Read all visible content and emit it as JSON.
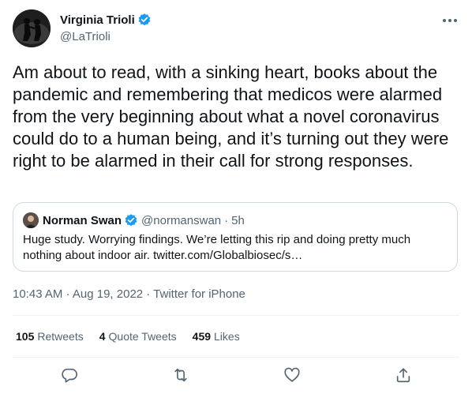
{
  "author": {
    "name": "Virginia Trioli",
    "handle": "@LaTrioli"
  },
  "tweet": {
    "text": "Am about to read, with a sinking heart, books about the pandemic and remembering that medicos were alarmed from the very beginning about what a novel coronavirus could do to a human being, and it’s turning out they were right to be alarmed in their call for strong responses."
  },
  "quote": {
    "name": "Norman Swan",
    "handle": "@normanswan",
    "dot": "·",
    "time": "5h",
    "text": "Huge study. Worrying findings. We’re letting this rip and doing pretty much nothing about indoor air. twitter.com/Globalbiosec/s…"
  },
  "meta": {
    "line": "10:43 AM · Aug 19, 2022 · Twitter for iPhone"
  },
  "stats": {
    "retweets_count": "105",
    "retweets_label": "Retweets",
    "quotes_count": "4",
    "quotes_label": "Quote Tweets",
    "likes_count": "459",
    "likes_label": "Likes"
  },
  "colors": {
    "verified": "#1d9bf0",
    "secondary_text": "#536471",
    "border": "#cfd9de"
  },
  "icons": {
    "more": "more-icon",
    "reply": "reply-icon",
    "retweet": "retweet-icon",
    "like": "like-icon",
    "share": "share-icon"
  }
}
